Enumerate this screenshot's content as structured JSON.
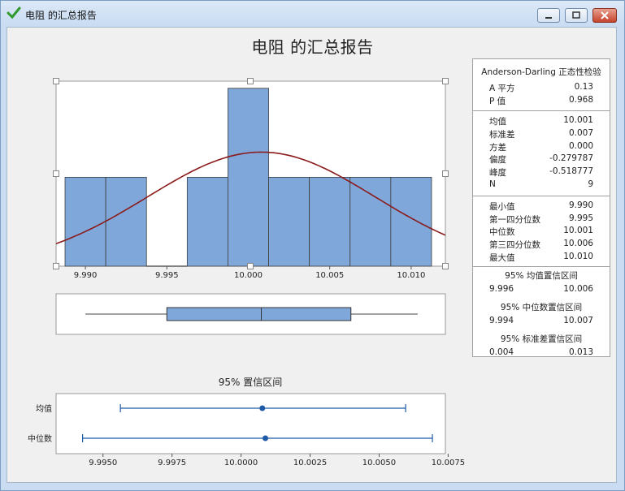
{
  "window": {
    "title": "电阻 的汇总报告"
  },
  "report_title": "电阻 的汇总报告",
  "stats": {
    "ad_header": "Anderson-Darling 正态性检验",
    "ad_rows": [
      {
        "label": "A 平方",
        "value": "0.13"
      },
      {
        "label": "P 值",
        "value": "0.968"
      }
    ],
    "desc_rows": [
      {
        "label": "均值",
        "value": "10.001"
      },
      {
        "label": "标准差",
        "value": "0.007"
      },
      {
        "label": "方差",
        "value": "0.000"
      },
      {
        "label": "偏度",
        "value": "-0.279787"
      },
      {
        "label": "峰度",
        "value": "-0.518777"
      },
      {
        "label": "N",
        "value": "9"
      }
    ],
    "quartile_rows": [
      {
        "label": "最小值",
        "value": "9.990"
      },
      {
        "label": "第一四分位数",
        "value": "9.995"
      },
      {
        "label": "中位数",
        "value": "10.001"
      },
      {
        "label": "第三四分位数",
        "value": "10.006"
      },
      {
        "label": "最大值",
        "value": "10.010"
      }
    ],
    "ci_blocks": [
      {
        "title": "95% 均值置信区间",
        "low": "9.996",
        "high": "10.006"
      },
      {
        "title": "95% 中位数置信区间",
        "low": "9.994",
        "high": "10.007"
      },
      {
        "title": "95% 标准差置信区间",
        "low": "0.004",
        "high": "0.013"
      }
    ]
  },
  "chart_data": [
    {
      "type": "bar",
      "subtype": "histogram",
      "bin_width": 0.0025,
      "bin_centers": [
        9.99,
        9.9925,
        9.995,
        9.9975,
        10.0,
        10.0025,
        10.005,
        10.0075,
        10.01
      ],
      "values": [
        1,
        1,
        0,
        1,
        2,
        1,
        1,
        1,
        1
      ],
      "xlim": [
        9.9882,
        10.0121
      ],
      "ylim": [
        0,
        2.08
      ],
      "tick_labels": [
        "9.990",
        "9.995",
        "10.000",
        "10.005",
        "10.010"
      ],
      "tick_values": [
        9.99,
        9.995,
        10.0,
        10.005,
        10.01
      ],
      "normal_fit": {
        "mean": 10.0008,
        "sd": 0.007
      },
      "colors": {
        "bar": "#7fa7d9",
        "bar_edge": "#3d3d3d",
        "curve": "#8b1a1a"
      }
    },
    {
      "type": "boxplot",
      "min": 9.99,
      "q1": 9.995,
      "median": 10.0008,
      "q3": 10.0063,
      "max": 10.0104,
      "xlim": [
        9.9882,
        10.0121
      ],
      "colors": {
        "box": "#7fa7d9"
      }
    },
    {
      "type": "interval",
      "title": "95% 置信区间",
      "categories": [
        "均值",
        "中位数"
      ],
      "intervals": [
        {
          "name": "均值",
          "low": 9.99563,
          "center": 10.00077,
          "high": 10.00596
        },
        {
          "name": "中位数",
          "low": 9.99426,
          "center": 10.00088,
          "high": 10.00693
        }
      ],
      "xlim": [
        9.9933,
        10.0074
      ],
      "tick_labels": [
        "9.9950",
        "9.9975",
        "10.0000",
        "10.0025",
        "10.0050",
        "10.0075"
      ],
      "tick_values": [
        9.995,
        9.9975,
        10.0,
        10.0025,
        10.005,
        10.0075
      ],
      "colors": {
        "line": "#1f5aa6"
      }
    }
  ]
}
